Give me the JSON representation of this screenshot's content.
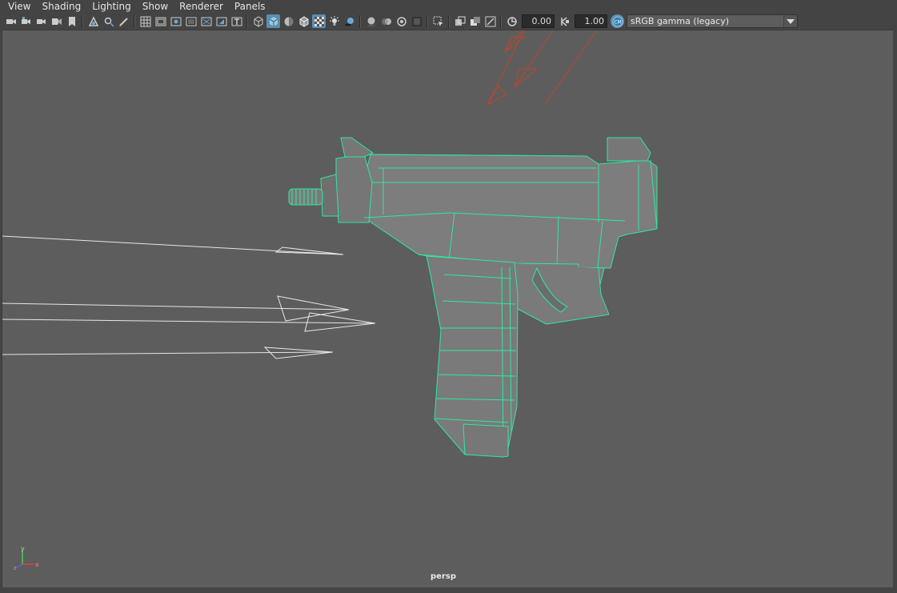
{
  "menu": [
    "View",
    "Shading",
    "Lighting",
    "Show",
    "Renderer",
    "Panels"
  ],
  "toolbar": {
    "exposure_value": "0.00",
    "gamma_value": "1.00",
    "color_space": "sRGB gamma (legacy)"
  },
  "viewport": {
    "camera_label": "persp",
    "axis": {
      "y": "y",
      "x": "x",
      "z": "z"
    }
  },
  "colors": {
    "viewport_bg": "#5d5d5d",
    "wire": "#2ee8a0",
    "model_fill": "#7a7a7a",
    "ui_bg": "#444444",
    "active_button": "#5a8fb3",
    "light_red": "#c0442a"
  }
}
